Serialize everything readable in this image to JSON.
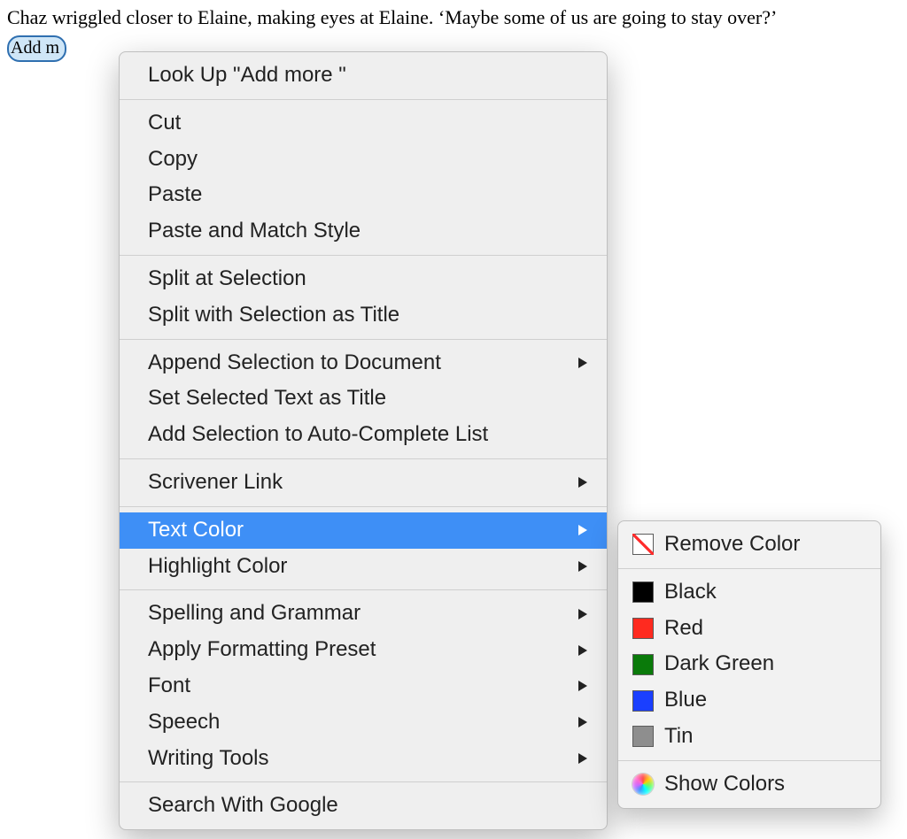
{
  "document": {
    "line1": "Chaz wriggled closer to Elaine, making eyes at Elaine. ‘Maybe some of us are going to stay over?’",
    "annotation_visible": "Add m"
  },
  "context_menu": {
    "lookup": "Look Up \"Add more \"",
    "cut": "Cut",
    "copy": "Copy",
    "paste": "Paste",
    "paste_match": "Paste and Match Style",
    "split_at": "Split at Selection",
    "split_with": "Split with Selection as Title",
    "append_sel": "Append Selection to Document",
    "set_title": "Set Selected Text as Title",
    "add_autocomplete": "Add Selection to Auto-Complete List",
    "scrivener_link": "Scrivener Link",
    "text_color": "Text Color",
    "highlight_color": "Highlight Color",
    "spelling": "Spelling and Grammar",
    "apply_preset": "Apply Formatting Preset",
    "font": "Font",
    "speech": "Speech",
    "writing_tools": "Writing Tools",
    "search_google": "Search With Google"
  },
  "text_color_submenu": {
    "remove": "Remove Color",
    "black": "Black",
    "red": "Red",
    "dark_green": "Dark Green",
    "blue": "Blue",
    "tin": "Tin",
    "show_colors": "Show Colors"
  },
  "swatches": {
    "black": "#000000",
    "red": "#ff2a1f",
    "dark_green": "#0a7a0a",
    "blue": "#1a3fff",
    "tin": "#8e8e8e"
  }
}
